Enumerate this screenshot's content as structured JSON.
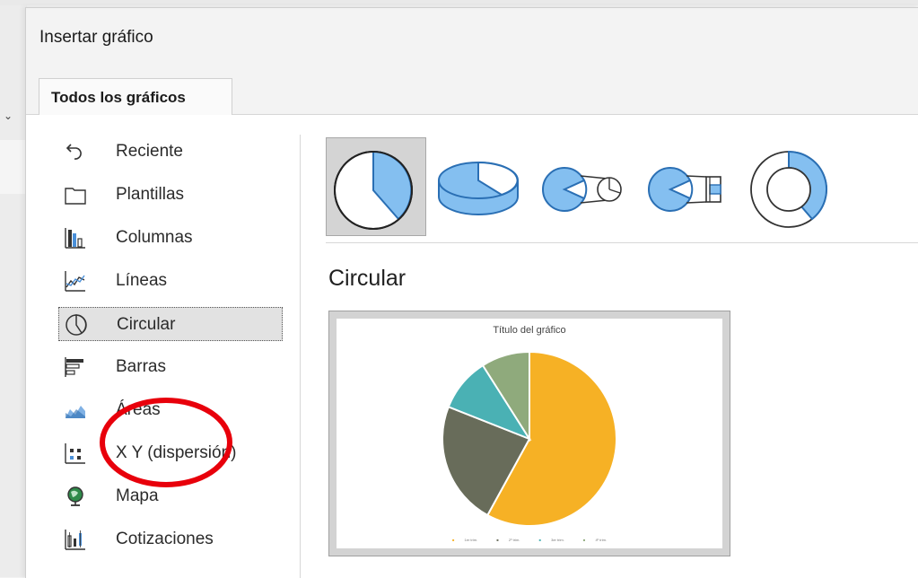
{
  "dialog": {
    "title": "Insertar gráfico"
  },
  "tabs": [
    {
      "label": "Todos los gráficos"
    }
  ],
  "categories": [
    {
      "label": "Reciente",
      "icon": "recent-icon"
    },
    {
      "label": "Plantillas",
      "icon": "templates-folder-icon"
    },
    {
      "label": "Columnas",
      "icon": "column-chart-icon"
    },
    {
      "label": "Líneas",
      "icon": "line-chart-icon"
    },
    {
      "label": "Circular",
      "icon": "pie-chart-icon",
      "selected": true
    },
    {
      "label": "Barras",
      "icon": "bar-chart-icon"
    },
    {
      "label": "Áreas",
      "icon": "area-chart-icon"
    },
    {
      "label": "X Y (dispersión)",
      "icon": "scatter-chart-icon"
    },
    {
      "label": "Mapa",
      "icon": "map-globe-icon"
    },
    {
      "label": "Cotizaciones",
      "icon": "stock-chart-icon"
    }
  ],
  "subtypes": [
    {
      "icon": "pie-icon",
      "selected": true
    },
    {
      "icon": "pie-3d-icon"
    },
    {
      "icon": "pie-of-pie-icon"
    },
    {
      "icon": "bar-of-pie-icon"
    },
    {
      "icon": "doughnut-icon"
    }
  ],
  "main": {
    "heading": "Circular"
  },
  "chart_data": {
    "type": "pie",
    "title": "Título del gráfico",
    "categories": [
      "1er trim.",
      "2º trim.",
      "3er trim.",
      "4º trim."
    ],
    "values": [
      58,
      23,
      10,
      9
    ],
    "colors": [
      "#F6B125",
      "#686C5A",
      "#4AB1B4",
      "#8FAA7C"
    ]
  },
  "annotation": {
    "color": "#E8000B",
    "shape": "ellipse"
  }
}
